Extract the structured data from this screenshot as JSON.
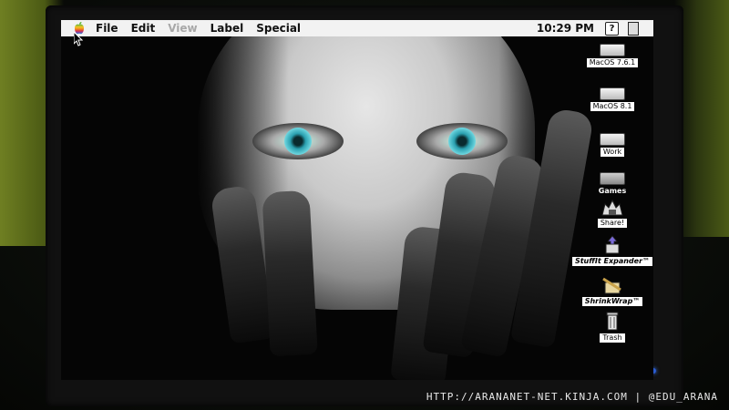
{
  "menubar": {
    "apple_icon": "apple-rainbow-icon",
    "items": [
      "File",
      "Edit",
      "View",
      "Label",
      "Special"
    ],
    "disabled_item": "View",
    "clock": "10:29 PM",
    "help_icon": "balloon-help-icon",
    "app_icon": "finder-app-icon"
  },
  "desktop_icons": [
    {
      "label": "MacOS 7.6.1",
      "icon": "hard-drive-icon"
    },
    {
      "label": "MacOS 8.1",
      "icon": "hard-drive-icon"
    },
    {
      "label": "Work",
      "icon": "hard-drive-icon"
    },
    {
      "label": "Games",
      "icon": "hard-drive-icon"
    },
    {
      "label": "Share!",
      "icon": "shared-folder-icon"
    },
    {
      "label": "StuffIt Expander™",
      "icon": "stuffit-expander-icon"
    },
    {
      "label": "ShrinkWrap™",
      "icon": "shrinkwrap-icon"
    },
    {
      "label": "Trash",
      "icon": "trash-icon"
    }
  ],
  "watermark": "HTTP://ARANANET-NET.KINJA.COM | @EDU_ARANA",
  "colors": {
    "menubar_bg": "#f2f2f2",
    "desktop_bg": "#050505",
    "eye_blue": "#2aa0b0"
  }
}
